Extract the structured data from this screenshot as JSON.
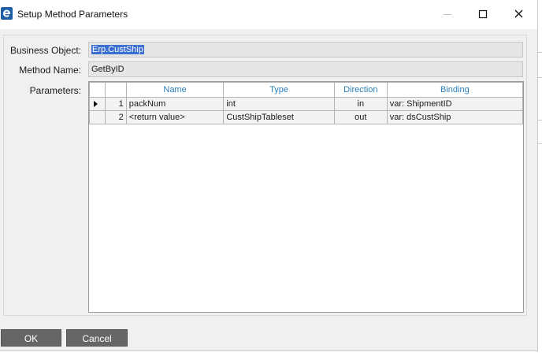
{
  "window": {
    "title": "Setup Method Parameters",
    "icon": "epicor-e-icon"
  },
  "titlebar_buttons": [
    "minimize-icon",
    "maximize-icon",
    "close-icon"
  ],
  "form": {
    "business_object_label": "Business Object:",
    "business_object_value": "Erp.CustShip",
    "method_name_label": "Method Name:",
    "method_name_value": "GetByID",
    "parameters_label": "Parameters:"
  },
  "grid": {
    "columns": [
      "Name",
      "Type",
      "Direction",
      "Binding"
    ],
    "rows": [
      {
        "index": "1",
        "name": "packNum",
        "type": "int",
        "direction": "in",
        "binding": "var: ShipmentID",
        "current": true
      },
      {
        "index": "2",
        "name": "<return value>",
        "type": "CustShipTableset",
        "direction": "out",
        "binding": "var: dsCustShip",
        "current": false
      }
    ]
  },
  "buttons": {
    "ok": "OK",
    "cancel": "Cancel"
  },
  "colors": {
    "header_text": "#2a7fb7",
    "selection": "#3b6fd1",
    "button_bg": "#666666"
  }
}
